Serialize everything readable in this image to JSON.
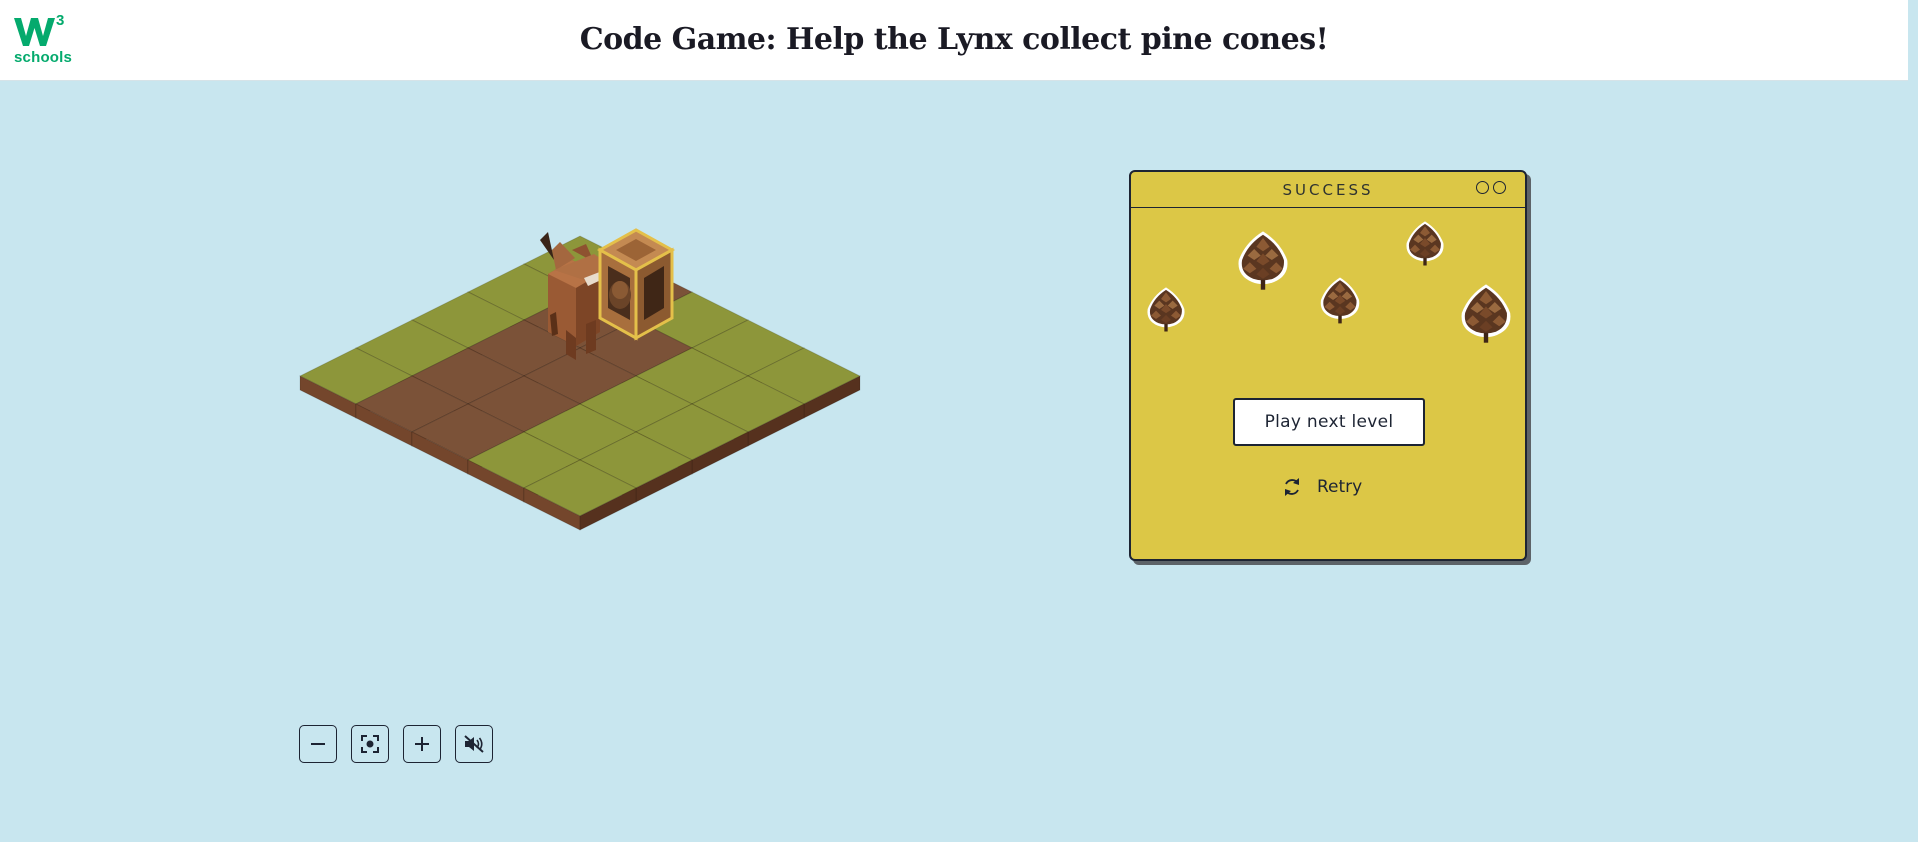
{
  "header": {
    "logo_superscript": "3",
    "logo_text": "schools",
    "title": "Code Game: Help the Lynx collect pine cones!"
  },
  "board": {
    "grid_rows": 5,
    "grid_cols": 5,
    "character": "lynx",
    "item": "crate-with-pine-cone"
  },
  "controls": [
    {
      "name": "zoom-out-button",
      "icon": "minus-icon"
    },
    {
      "name": "recenter-button",
      "icon": "focus-icon"
    },
    {
      "name": "zoom-in-button",
      "icon": "plus-icon"
    },
    {
      "name": "mute-button",
      "icon": "speaker-muted-icon"
    }
  ],
  "dialog": {
    "title": "SUCCESS",
    "pine_cone_count": 5,
    "next_button_label": "Play next level",
    "retry_label": "Retry"
  },
  "colors": {
    "background": "#c8e6ef",
    "grass": "#8d963a",
    "dirt": "#7b5238",
    "dialog_bg": "#dcc746",
    "brand_green": "#04aa6d"
  }
}
